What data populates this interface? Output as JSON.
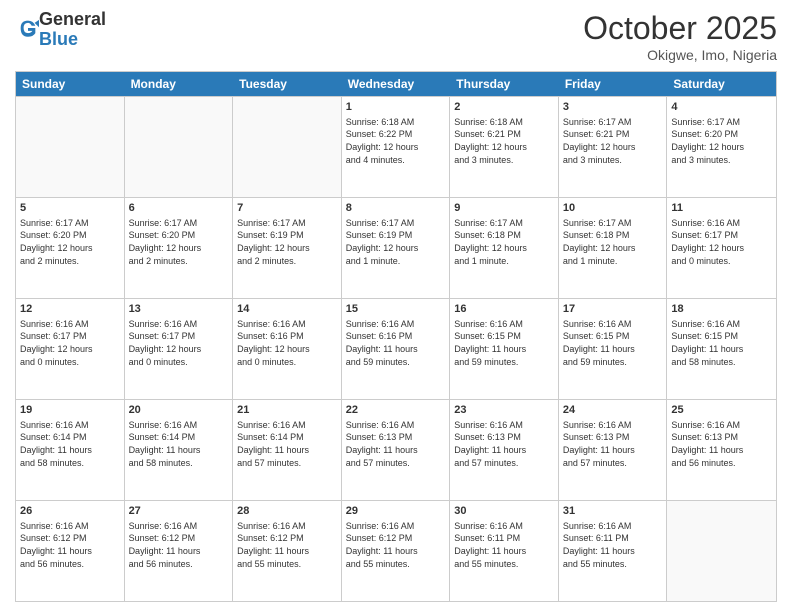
{
  "logo": {
    "general": "General",
    "blue": "Blue"
  },
  "header": {
    "month": "October 2025",
    "location": "Okigwe, Imo, Nigeria"
  },
  "days": [
    "Sunday",
    "Monday",
    "Tuesday",
    "Wednesday",
    "Thursday",
    "Friday",
    "Saturday"
  ],
  "rows": [
    [
      {
        "day": "",
        "info": ""
      },
      {
        "day": "",
        "info": ""
      },
      {
        "day": "",
        "info": ""
      },
      {
        "day": "1",
        "info": "Sunrise: 6:18 AM\nSunset: 6:22 PM\nDaylight: 12 hours\nand 4 minutes."
      },
      {
        "day": "2",
        "info": "Sunrise: 6:18 AM\nSunset: 6:21 PM\nDaylight: 12 hours\nand 3 minutes."
      },
      {
        "day": "3",
        "info": "Sunrise: 6:17 AM\nSunset: 6:21 PM\nDaylight: 12 hours\nand 3 minutes."
      },
      {
        "day": "4",
        "info": "Sunrise: 6:17 AM\nSunset: 6:20 PM\nDaylight: 12 hours\nand 3 minutes."
      }
    ],
    [
      {
        "day": "5",
        "info": "Sunrise: 6:17 AM\nSunset: 6:20 PM\nDaylight: 12 hours\nand 2 minutes."
      },
      {
        "day": "6",
        "info": "Sunrise: 6:17 AM\nSunset: 6:20 PM\nDaylight: 12 hours\nand 2 minutes."
      },
      {
        "day": "7",
        "info": "Sunrise: 6:17 AM\nSunset: 6:19 PM\nDaylight: 12 hours\nand 2 minutes."
      },
      {
        "day": "8",
        "info": "Sunrise: 6:17 AM\nSunset: 6:19 PM\nDaylight: 12 hours\nand 1 minute."
      },
      {
        "day": "9",
        "info": "Sunrise: 6:17 AM\nSunset: 6:18 PM\nDaylight: 12 hours\nand 1 minute."
      },
      {
        "day": "10",
        "info": "Sunrise: 6:17 AM\nSunset: 6:18 PM\nDaylight: 12 hours\nand 1 minute."
      },
      {
        "day": "11",
        "info": "Sunrise: 6:16 AM\nSunset: 6:17 PM\nDaylight: 12 hours\nand 0 minutes."
      }
    ],
    [
      {
        "day": "12",
        "info": "Sunrise: 6:16 AM\nSunset: 6:17 PM\nDaylight: 12 hours\nand 0 minutes."
      },
      {
        "day": "13",
        "info": "Sunrise: 6:16 AM\nSunset: 6:17 PM\nDaylight: 12 hours\nand 0 minutes."
      },
      {
        "day": "14",
        "info": "Sunrise: 6:16 AM\nSunset: 6:16 PM\nDaylight: 12 hours\nand 0 minutes."
      },
      {
        "day": "15",
        "info": "Sunrise: 6:16 AM\nSunset: 6:16 PM\nDaylight: 11 hours\nand 59 minutes."
      },
      {
        "day": "16",
        "info": "Sunrise: 6:16 AM\nSunset: 6:15 PM\nDaylight: 11 hours\nand 59 minutes."
      },
      {
        "day": "17",
        "info": "Sunrise: 6:16 AM\nSunset: 6:15 PM\nDaylight: 11 hours\nand 59 minutes."
      },
      {
        "day": "18",
        "info": "Sunrise: 6:16 AM\nSunset: 6:15 PM\nDaylight: 11 hours\nand 58 minutes."
      }
    ],
    [
      {
        "day": "19",
        "info": "Sunrise: 6:16 AM\nSunset: 6:14 PM\nDaylight: 11 hours\nand 58 minutes."
      },
      {
        "day": "20",
        "info": "Sunrise: 6:16 AM\nSunset: 6:14 PM\nDaylight: 11 hours\nand 58 minutes."
      },
      {
        "day": "21",
        "info": "Sunrise: 6:16 AM\nSunset: 6:14 PM\nDaylight: 11 hours\nand 57 minutes."
      },
      {
        "day": "22",
        "info": "Sunrise: 6:16 AM\nSunset: 6:13 PM\nDaylight: 11 hours\nand 57 minutes."
      },
      {
        "day": "23",
        "info": "Sunrise: 6:16 AM\nSunset: 6:13 PM\nDaylight: 11 hours\nand 57 minutes."
      },
      {
        "day": "24",
        "info": "Sunrise: 6:16 AM\nSunset: 6:13 PM\nDaylight: 11 hours\nand 57 minutes."
      },
      {
        "day": "25",
        "info": "Sunrise: 6:16 AM\nSunset: 6:13 PM\nDaylight: 11 hours\nand 56 minutes."
      }
    ],
    [
      {
        "day": "26",
        "info": "Sunrise: 6:16 AM\nSunset: 6:12 PM\nDaylight: 11 hours\nand 56 minutes."
      },
      {
        "day": "27",
        "info": "Sunrise: 6:16 AM\nSunset: 6:12 PM\nDaylight: 11 hours\nand 56 minutes."
      },
      {
        "day": "28",
        "info": "Sunrise: 6:16 AM\nSunset: 6:12 PM\nDaylight: 11 hours\nand 55 minutes."
      },
      {
        "day": "29",
        "info": "Sunrise: 6:16 AM\nSunset: 6:12 PM\nDaylight: 11 hours\nand 55 minutes."
      },
      {
        "day": "30",
        "info": "Sunrise: 6:16 AM\nSunset: 6:11 PM\nDaylight: 11 hours\nand 55 minutes."
      },
      {
        "day": "31",
        "info": "Sunrise: 6:16 AM\nSunset: 6:11 PM\nDaylight: 11 hours\nand 55 minutes."
      },
      {
        "day": "",
        "info": ""
      }
    ]
  ]
}
